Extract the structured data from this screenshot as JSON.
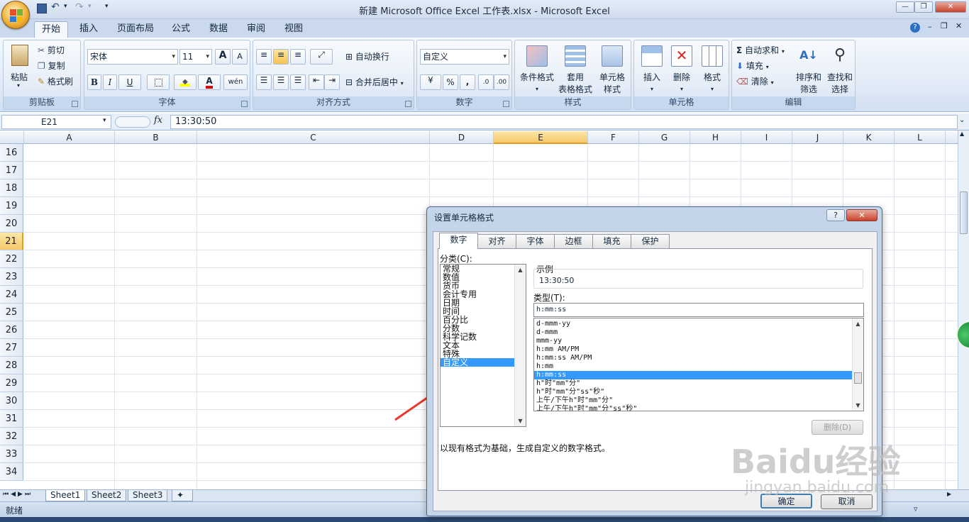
{
  "window": {
    "title": "新建 Microsoft Office Excel 工作表.xlsx - Microsoft Excel",
    "minimize": "—",
    "restore": "❐",
    "close": "✕"
  },
  "tabs": [
    "开始",
    "插入",
    "页面布局",
    "公式",
    "数据",
    "审阅",
    "视图"
  ],
  "ribbon": {
    "clipboard": {
      "label": "剪贴板",
      "paste": "粘贴",
      "cut": "剪切",
      "copy": "复制",
      "format_painter": "格式刷"
    },
    "font": {
      "label": "字体",
      "font_name": "宋体",
      "font_size": "11",
      "bold": "B",
      "italic": "I",
      "underline": "U",
      "grow": "A",
      "shrink": "A",
      "phonetic": "wén"
    },
    "alignment": {
      "label": "对齐方式",
      "wrap_text": "自动换行",
      "merge_center": "合并后居中"
    },
    "number": {
      "label": "数字",
      "format": "自定义",
      "percent": "%",
      "comma": ","
    },
    "styles": {
      "label": "样式",
      "conditional": "条件格式",
      "table_line1": "套用",
      "table_line2": "表格格式",
      "cell_line1": "单元格",
      "cell_line2": "样式"
    },
    "cells": {
      "label": "单元格",
      "insert": "插入",
      "delete": "删除",
      "format": "格式"
    },
    "editing": {
      "label": "编辑",
      "autosum": "自动求和",
      "fill": "填充",
      "clear": "清除",
      "sort_line1": "排序和",
      "sort_line2": "筛选",
      "find_line1": "查找和",
      "find_line2": "选择"
    }
  },
  "formula_bar": {
    "name_box": "E21",
    "fx": "fx",
    "value": "13:30:50"
  },
  "columns": [
    "A",
    "B",
    "C",
    "D",
    "E",
    "F",
    "G",
    "H",
    "I",
    "J",
    "K",
    "L"
  ],
  "rows": [
    "16",
    "17",
    "18",
    "19",
    "20",
    "21",
    "22",
    "23",
    "24",
    "25",
    "26",
    "27",
    "28",
    "29",
    "30",
    "31",
    "32",
    "33",
    "34"
  ],
  "selected_cell": {
    "column": "E",
    "row": "21"
  },
  "sheets": [
    "Sheet1",
    "Sheet2",
    "Sheet3"
  ],
  "status": {
    "text": "就绪"
  },
  "dialog": {
    "title": "设置单元格格式",
    "help": "?",
    "close": "✕",
    "tabs": [
      "数字",
      "对齐",
      "字体",
      "边框",
      "填充",
      "保护"
    ],
    "category_label": "分类(C):",
    "categories": [
      "常规",
      "数值",
      "货币",
      "会计专用",
      "日期",
      "时间",
      "百分比",
      "分数",
      "科学记数",
      "文本",
      "特殊",
      "自定义"
    ],
    "selected_category": "自定义",
    "sample_label": "示例",
    "sample_value": "13:30:50",
    "type_label": "类型(T):",
    "type_value": "h:mm:ss",
    "types": [
      "d-mmm-yy",
      "d-mmm",
      "mmm-yy",
      "h:mm AM/PM",
      "h:mm:ss AM/PM",
      "h:mm",
      "h:mm:ss",
      "h\"时\"mm\"分\"",
      "h\"时\"mm\"分\"ss\"秒\"",
      "上午/下午h\"时\"mm\"分\"",
      "上午/下午h\"时\"mm\"分\"ss\"秒\""
    ],
    "selected_type": "h:mm:ss",
    "delete_button": "删除(D)",
    "description": "以现有格式为基础，生成自定义的数字格式。",
    "ok": "确定",
    "cancel": "取消"
  },
  "watermark": {
    "line1": "Baidu经验",
    "line2": "jingyan.baidu.com"
  },
  "colors": {
    "accent": "#3399ff",
    "annotation_arrow": "#e8392c",
    "selected_header": "#f5c86a"
  }
}
